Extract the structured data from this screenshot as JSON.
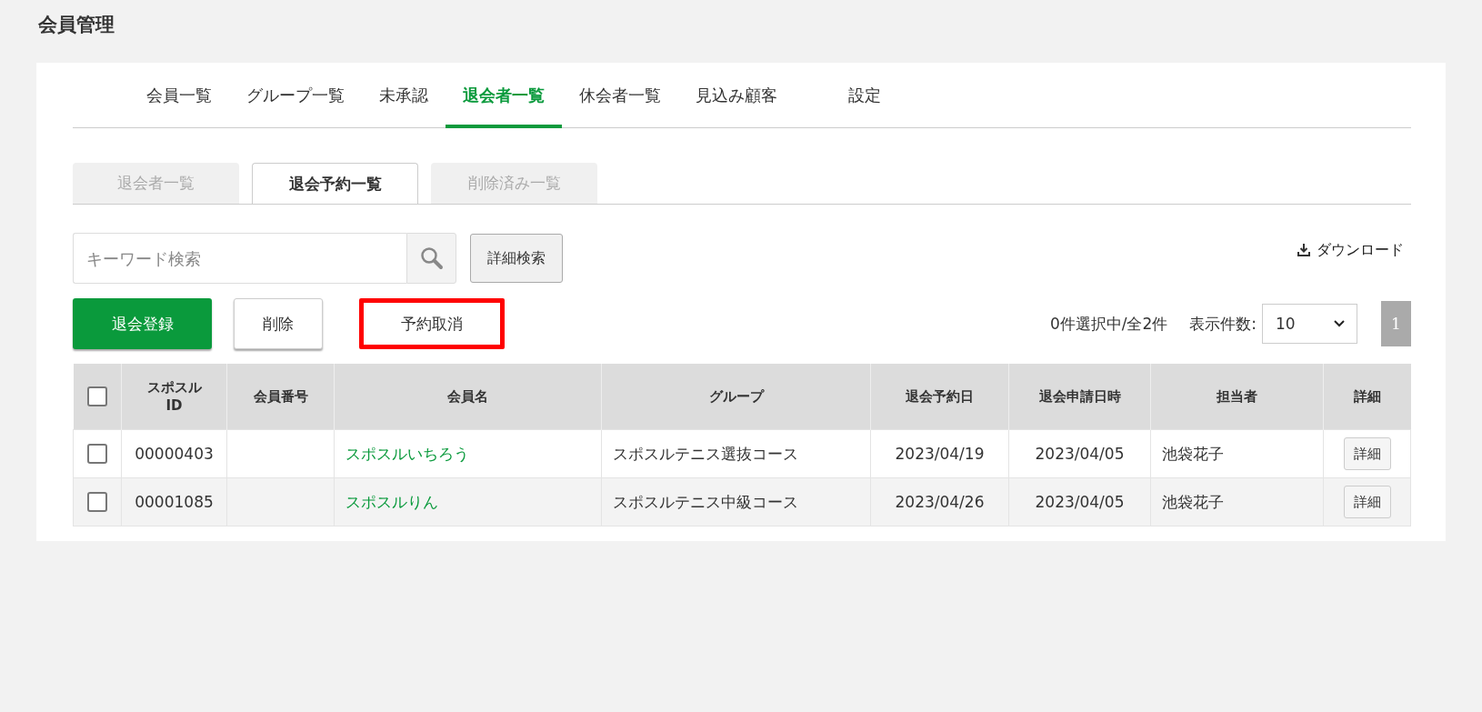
{
  "page_title": "会員管理",
  "tabs": [
    {
      "label": "会員一覧",
      "selected": false
    },
    {
      "label": "グループ一覧",
      "selected": false
    },
    {
      "label": "未承認",
      "selected": false
    },
    {
      "label": "退会者一覧",
      "selected": true
    },
    {
      "label": "休会者一覧",
      "selected": false
    },
    {
      "label": "見込み顧客",
      "selected": false
    },
    {
      "label": "設定",
      "selected": false
    }
  ],
  "subtabs": [
    {
      "label": "退会者一覧",
      "selected": false
    },
    {
      "label": "退会予約一覧",
      "selected": true
    },
    {
      "label": "削除済み一覧",
      "selected": false
    }
  ],
  "search": {
    "placeholder": "キーワード検索"
  },
  "advanced_search": "詳細検索",
  "download": "ダウンロード",
  "actions": [
    {
      "label": "退会登録",
      "kind": "primary",
      "highlighted": false
    },
    {
      "label": "削除",
      "kind": "secondary",
      "highlighted": false
    },
    {
      "label": "予約取消",
      "kind": "plain",
      "highlighted": true
    }
  ],
  "selection_count": "0件選択中/全2件",
  "page_size": {
    "label": "表示件数:",
    "value": "10"
  },
  "pages": [
    {
      "label": "1",
      "selected": true
    }
  ],
  "table": {
    "header_checked": false,
    "columns": [
      "スポスル\nID",
      "会員番号",
      "会員名",
      "グループ",
      "退会予約日",
      "退会申請日時",
      "担当者",
      "詳細"
    ],
    "rows": [
      {
        "checked": false,
        "id": "00000403",
        "member_no": "",
        "name": "スポスルいちろう",
        "group": "スポスルテニス選抜コース",
        "reservation_date": "2023/04/19",
        "request_date": "2023/04/05",
        "staff": "池袋花子",
        "detail": "詳細"
      },
      {
        "checked": false,
        "id": "00001085",
        "member_no": "",
        "name": "スポスルりん",
        "group": "スポスルテニス中級コース",
        "reservation_date": "2023/04/26",
        "request_date": "2023/04/05",
        "staff": "池袋花子",
        "detail": "詳細"
      }
    ]
  }
}
